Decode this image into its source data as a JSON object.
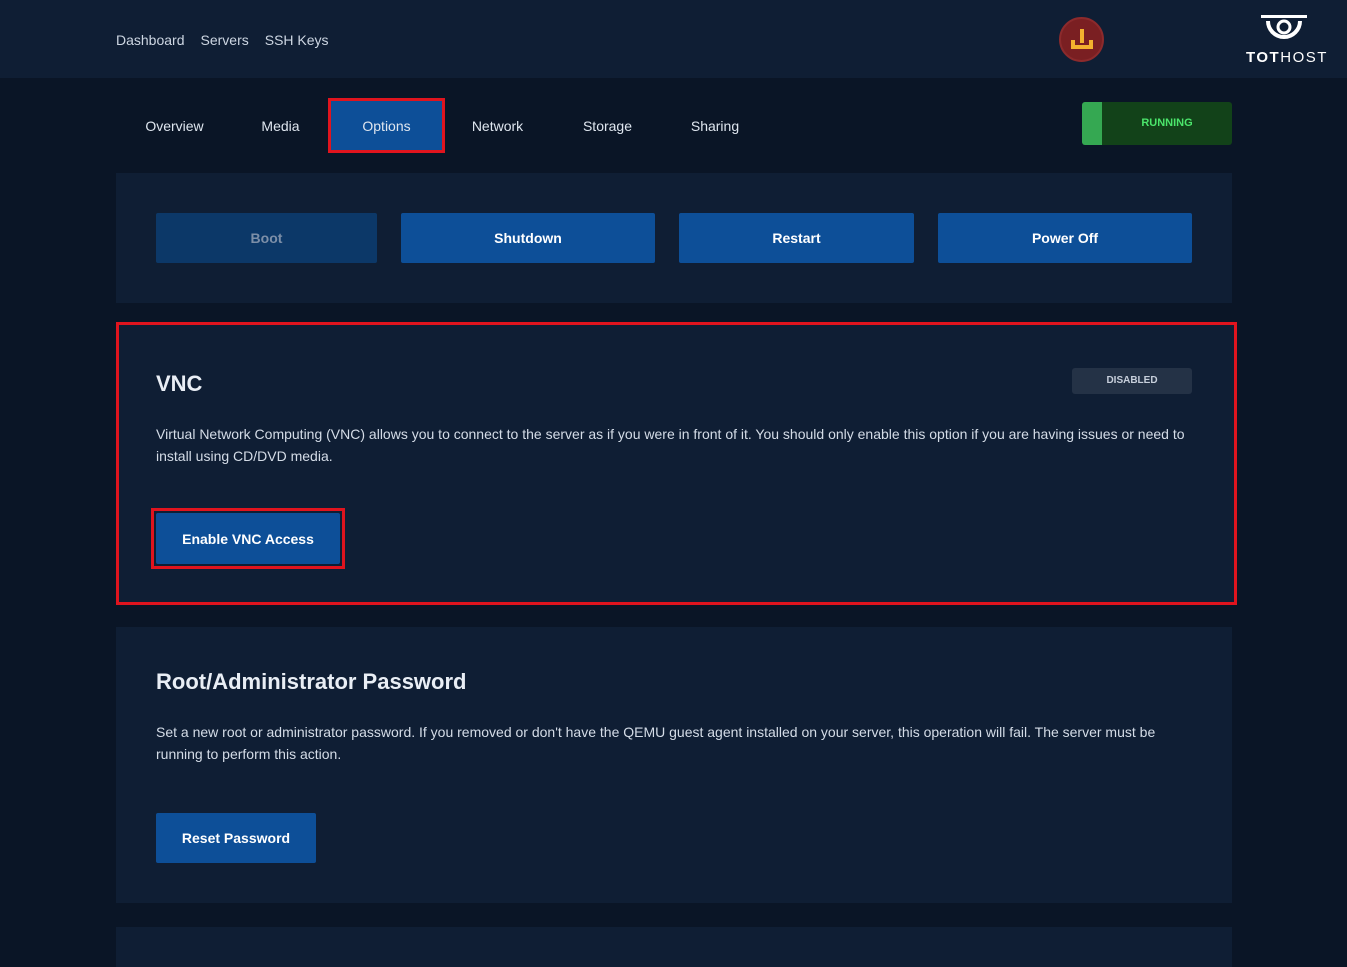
{
  "topnav": {
    "items": [
      "Dashboard",
      "Servers",
      "SSH Keys"
    ]
  },
  "brand": {
    "logo_bold": "TOT",
    "logo_thin": "HOST"
  },
  "tabs": [
    {
      "label": "Overview",
      "active": false
    },
    {
      "label": "Media",
      "active": false
    },
    {
      "label": "Options",
      "active": true
    },
    {
      "label": "Network",
      "active": false
    },
    {
      "label": "Storage",
      "active": false
    },
    {
      "label": "Sharing",
      "active": false
    }
  ],
  "server_status": "RUNNING",
  "power": {
    "boot": "Boot",
    "shutdown": "Shutdown",
    "restart": "Restart",
    "power_off": "Power Off"
  },
  "vnc": {
    "title": "VNC",
    "status": "DISABLED",
    "description": "Virtual Network Computing (VNC) allows you to connect to the server as if you were in front of it. You should only enable this option if you are having issues or need to install using CD/DVD media.",
    "button": "Enable VNC Access"
  },
  "password": {
    "title": "Root/Administrator Password",
    "description": "Set a new root or administrator password. If you removed or don't have the QEMU guest agent installed on your server, this operation will fail. The server must be running to perform this action.",
    "button": "Reset Password"
  },
  "colors": {
    "background": "#0a1526",
    "card": "#0f1e34",
    "primary_button": "#0d4f98",
    "running": "#124219",
    "running_text": "#4be56b",
    "highlight": "#e0141e"
  }
}
